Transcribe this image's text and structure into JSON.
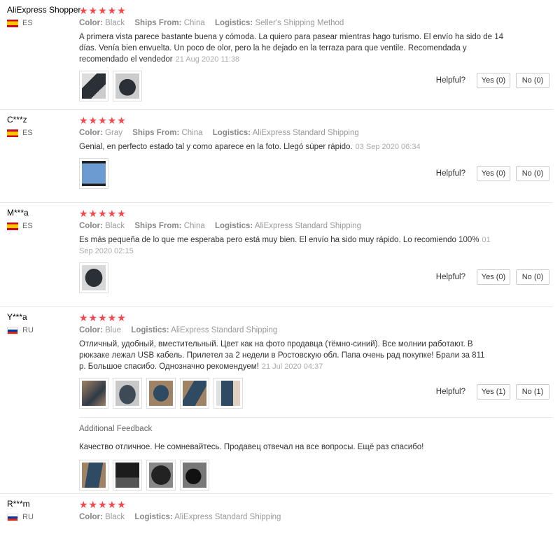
{
  "labels": {
    "color": "Color:",
    "ships_from": "Ships From:",
    "logistics": "Logistics:",
    "helpful": "Helpful?",
    "additional_feedback": "Additional Feedback"
  },
  "reviews": [
    {
      "user": "AliExpress Shopper",
      "country": "ES",
      "stars": "★★★★★",
      "color": "Black",
      "ships_from": "China",
      "logistics": "Seller's Shipping Method",
      "text": "A primera vista parece bastante buena y cómoda. La quiero para pasear mientras hago turismo. El envío ha sido de 14 días. Venía bien envuelta. Un poco de olor, pero la he dejado en la terraza para que ventile. Recomendada y recomendado el vendedor",
      "date": "21 Aug 2020 11:38",
      "yes": "Yes (0)",
      "no": "No (0)"
    },
    {
      "user": "C***z",
      "country": "ES",
      "stars": "★★★★★",
      "color": "Gray",
      "ships_from": "China",
      "logistics": "AliExpress Standard Shipping",
      "text": "Genial, en perfecto estado tal y como aparece en la foto. Llegó súper rápido.",
      "date": "03 Sep 2020 06:34",
      "yes": "Yes (0)",
      "no": "No (0)"
    },
    {
      "user": "M***a",
      "country": "ES",
      "stars": "★★★★★",
      "color": "Black",
      "ships_from": "China",
      "logistics": "AliExpress Standard Shipping",
      "text": "Es más pequeña de lo que me esperaba pero está muy bien. El envío ha sido muy rápido. Lo recomiendo 100%",
      "date": "01 Sep 2020 02:15",
      "yes": "Yes (0)",
      "no": "No (0)"
    },
    {
      "user": "Y***a",
      "country": "RU",
      "stars": "★★★★★",
      "color": "Blue",
      "logistics": "AliExpress Standard Shipping",
      "text": "Отличный, удобный, вместительный. Цвет как на фото продавца (тёмно-синий). Все молнии работают. В рюкзаке лежал USB кабель. Прилетел за 2 недели в Ростовскую обл. Папа очень рад покупке! Брали за 811 р. Большое спасибо. Однозначно рекомендуем!",
      "date": "21 Jul 2020 04:37",
      "yes": "Yes (1)",
      "no": "No (1)",
      "additional_text": "Качество отличное. Не сомневайтесь. Продавец отвечал на все вопросы. Ещё раз спасибо!"
    },
    {
      "user": "R***m",
      "country": "RU",
      "stars": "★★★★★",
      "color": "Black",
      "logistics": "AliExpress Standard Shipping"
    }
  ],
  "thumb_colors": {
    "black": "#2b2f36",
    "gray": "#6b7f99",
    "blue": "#2f4a63",
    "tan": "#a08264"
  }
}
